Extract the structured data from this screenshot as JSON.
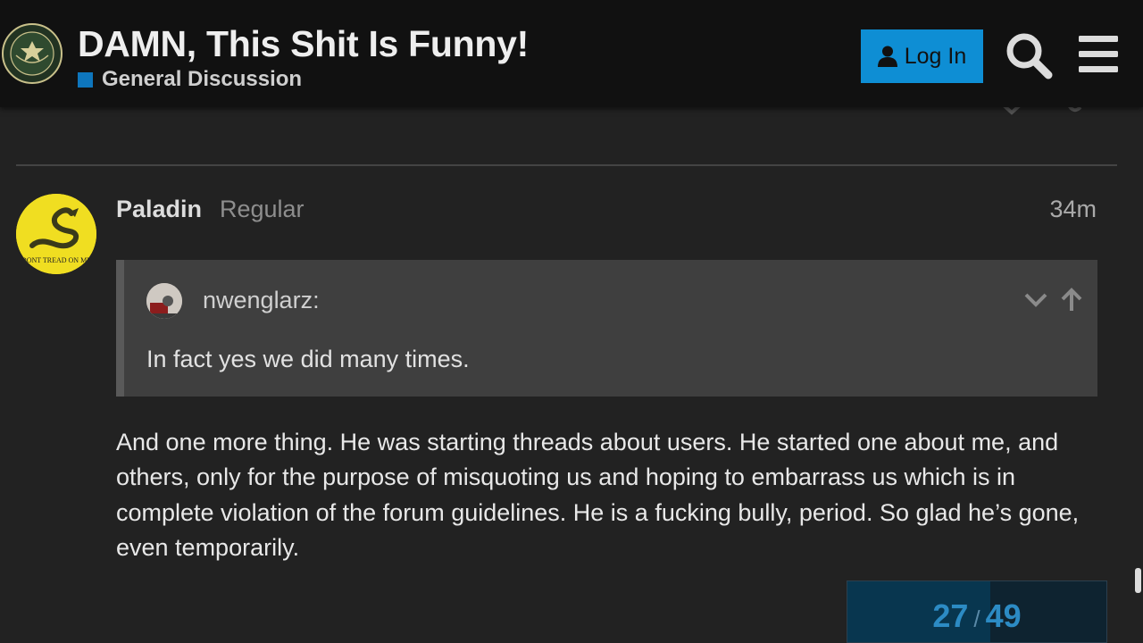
{
  "header": {
    "title": "DAMN, This Shit Is Funny!",
    "category": "General Discussion",
    "category_color": "#0e76bd",
    "login_label": "Log In",
    "login_color": "#0e8ed4",
    "logo_icon": "army-seal-logo",
    "search_icon": "search-icon",
    "menu_icon": "hamburger-menu-icon"
  },
  "post": {
    "username": "Paladin",
    "user_title": "Regular",
    "date": "34m",
    "avatar_icon": "gadsden-flag-avatar",
    "quote": {
      "author": "nwenglarz:",
      "text": "In fact yes we did many times."
    },
    "body": "And one more thing. He was starting threads about users. He started one about me, and others, only for the purpose of misquoting us and hoping to embarrass us which is in complete violation of the forum guidelines. He is a fucking bully, period. So glad he’s gone, even temporarily."
  },
  "timeline": {
    "current": "27",
    "separator": "/",
    "total": "49",
    "progress_fraction": 0.551
  }
}
